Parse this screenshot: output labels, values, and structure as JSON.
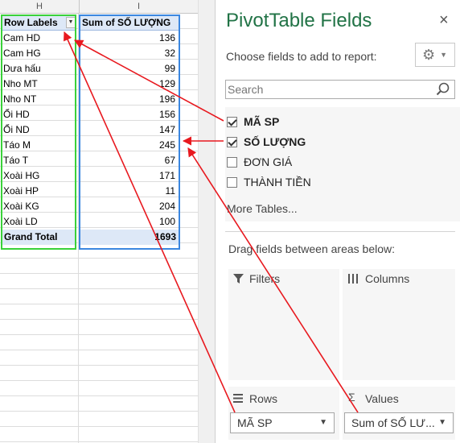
{
  "sheet": {
    "col_h": "H",
    "col_i": "I",
    "header_row_labels": "Row Labels",
    "header_sum": "Sum of SỐ LƯỢNG",
    "rows": [
      {
        "label": "Cam HD",
        "value": "136"
      },
      {
        "label": "Cam HG",
        "value": "32"
      },
      {
        "label": "Dưa hấu",
        "value": "99"
      },
      {
        "label": "Nho MT",
        "value": "129"
      },
      {
        "label": "Nho NT",
        "value": "196"
      },
      {
        "label": "Ổi HD",
        "value": "156"
      },
      {
        "label": "Ổi ND",
        "value": "147"
      },
      {
        "label": "Táo M",
        "value": "245"
      },
      {
        "label": "Táo T",
        "value": "67"
      },
      {
        "label": "Xoài HG",
        "value": "171"
      },
      {
        "label": "Xoài HP",
        "value": "11"
      },
      {
        "label": "Xoài KG",
        "value": "204"
      },
      {
        "label": "Xoài LD",
        "value": "100"
      }
    ],
    "grand_total_label": "Grand Total",
    "grand_total_value": "1693"
  },
  "panel": {
    "title": "PivotTable Fields",
    "close": "×",
    "choose_text": "Choose fields to add to report:",
    "gear_icon": "gear-icon",
    "search_placeholder": "Search",
    "fields": [
      {
        "name": "MÃ SP",
        "checked": true
      },
      {
        "name": "SỐ LƯỢNG",
        "checked": true
      },
      {
        "name": "ĐƠN GIÁ",
        "checked": false
      },
      {
        "name": "THÀNH TIỀN",
        "checked": false
      }
    ],
    "more_tables": "More Tables...",
    "drag_text": "Drag fields between areas below:",
    "areas": {
      "filters": "Filters",
      "columns": "Columns",
      "rows": "Rows",
      "values": "Values"
    },
    "rows_pill": "MÃ SP",
    "values_pill": "Sum of SỐ LƯ..."
  },
  "colors": {
    "title_green": "#217346",
    "green_box": "#3ad13a",
    "blue_box": "#3b87e0",
    "arrow_red": "#e8191f"
  }
}
